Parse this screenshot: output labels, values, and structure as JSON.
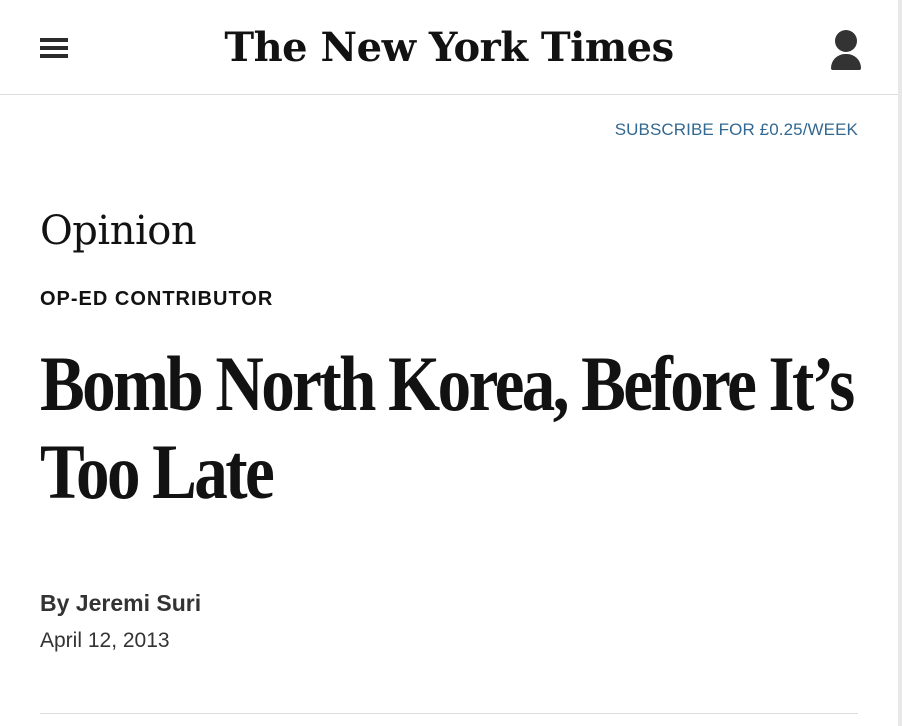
{
  "header": {
    "logo_text": "The New York Times",
    "menu_icon": "hamburger-menu-icon",
    "account_icon": "user-account-icon"
  },
  "subscribe": {
    "label": "SUBSCRIBE FOR £0.25/WEEK"
  },
  "article": {
    "section": "Opinion",
    "kicker": "OP-ED CONTRIBUTOR",
    "headline": "Bomb North Korea, Before It’s Too Late",
    "byline_prefix": "By",
    "author": "Jeremi Suri",
    "date": "April 12, 2013"
  },
  "colors": {
    "link_blue": "#326891",
    "text": "#121212",
    "divider": "#dcdcdc"
  }
}
